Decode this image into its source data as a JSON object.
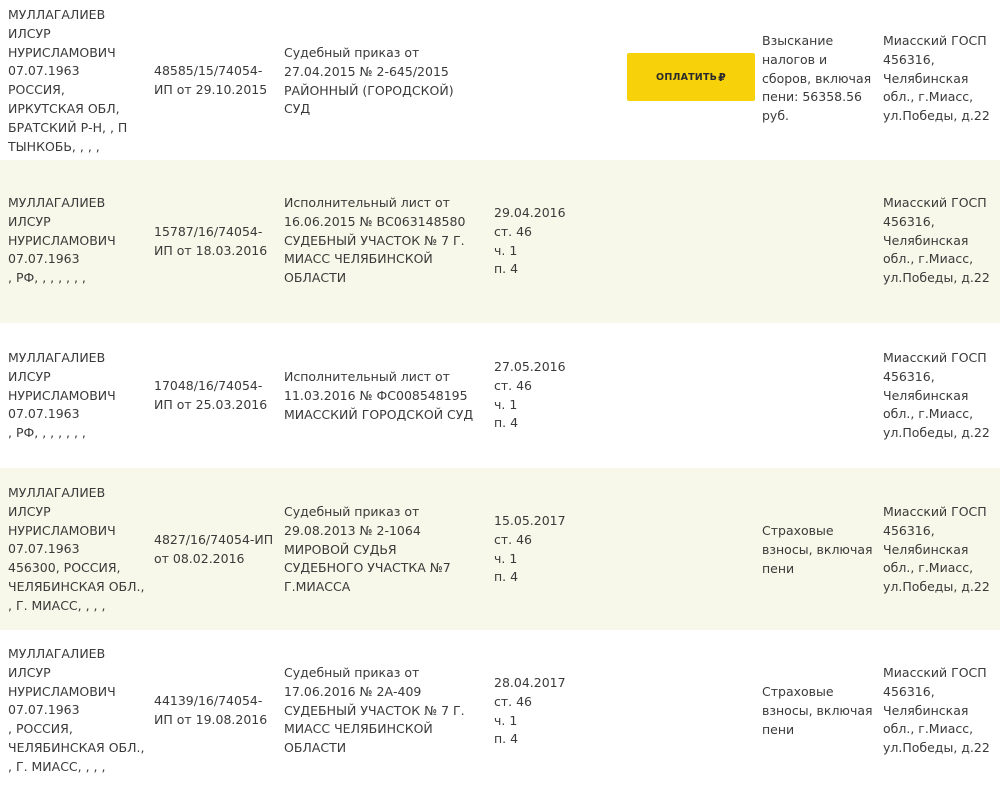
{
  "pay_button": {
    "label": "ОПЛАТИТЬ",
    "currency_icon": "₽"
  },
  "rows": [
    {
      "debtor": "МУЛЛАГАЛИЕВ\nИЛСУР\nНУРИСЛАМОВИЧ\n07.07.1963\nРОССИЯ,\nИРКУТСКАЯ ОБЛ,\nБРАТСКИЙ Р-Н, , П\nТЫНКОБЬ, , , ,",
      "proceeding": "48585/15/74054-\nИП от 29.10.2015",
      "document": "Судебный приказ от\n27.04.2015 № 2-645/2015\nРАЙОННЫЙ (ГОРОДСКОЙ)\nСУД",
      "termination": "",
      "subject": "Взыскание\nналогов и\nсборов, включая\nпени: 56358.56\nруб.",
      "department": "Миасский ГОСП\n456316,\nЧелябинская\nобл., г.Миасс,\nул.Победы, д.22"
    },
    {
      "debtor": "МУЛЛАГАЛИЕВ\nИЛСУР\nНУРИСЛАМОВИЧ\n07.07.1963\n, РФ, , , , , , ,",
      "proceeding": "15787/16/74054-\nИП от 18.03.2016",
      "document": "Исполнительный лист от\n16.06.2015 № ВС063148580\nСУДЕБНЫЙ УЧАСТОК № 7 Г.\nМИАСС ЧЕЛЯБИНСКОЙ\nОБЛАСТИ",
      "termination": "29.04.2016\nст. 46\nч. 1\nп. 4",
      "subject": "",
      "department": "Миасский ГОСП\n456316,\nЧелябинская\nобл., г.Миасс,\nул.Победы, д.22"
    },
    {
      "debtor": "МУЛЛАГАЛИЕВ\nИЛСУР\nНУРИСЛАМОВИЧ\n07.07.1963\n, РФ, , , , , , ,",
      "proceeding": "17048/16/74054-\nИП от 25.03.2016",
      "document": "Исполнительный лист от\n11.03.2016 № ФС008548195\nМИАССКИЙ ГОРОДСКОЙ СУД",
      "termination": "27.05.2016\nст. 46\nч. 1\nп. 4",
      "subject": "",
      "department": "Миасский ГОСП\n456316,\nЧелябинская\nобл., г.Миасс,\nул.Победы, д.22"
    },
    {
      "debtor": "МУЛЛАГАЛИЕВ\nИЛСУР\nНУРИСЛАМОВИЧ\n07.07.1963\n456300, РОССИЯ,\nЧЕЛЯБИНСКАЯ ОБЛ.,\n, Г. МИАСС, , , ,",
      "proceeding": "4827/16/74054-ИП\nот 08.02.2016",
      "document": "Судебный приказ от\n29.08.2013 № 2-1064\nМИРОВОЙ СУДЬЯ\nСУДЕБНОГО УЧАСТКА №7\nГ.МИАССА",
      "termination": "15.05.2017\nст. 46\nч. 1\nп. 4",
      "subject": "Страховые\nвзносы, включая\nпени",
      "department": "Миасский ГОСП\n456316,\nЧелябинская\nобл., г.Миасс,\nул.Победы, д.22"
    },
    {
      "debtor": "МУЛЛАГАЛИЕВ\nИЛСУР\nНУРИСЛАМОВИЧ\n07.07.1963\n, РОССИЯ,\nЧЕЛЯБИНСКАЯ ОБЛ.,\n, Г. МИАСС, , , ,",
      "proceeding": "44139/16/74054-\nИП от 19.08.2016",
      "document": "Судебный приказ от\n17.06.2016 № 2А-409\nСУДЕБНЫЙ УЧАСТОК № 7 Г.\nМИАСС ЧЕЛЯБИНСКОЙ\nОБЛАСТИ",
      "termination": "28.04.2017\nст. 46\nч. 1\nп. 4",
      "subject": "Страховые\nвзносы, включая\nпени",
      "department": "Миасский ГОСП\n456316,\nЧелябинская\nобл., г.Миасс,\nул.Победы, д.22"
    }
  ]
}
